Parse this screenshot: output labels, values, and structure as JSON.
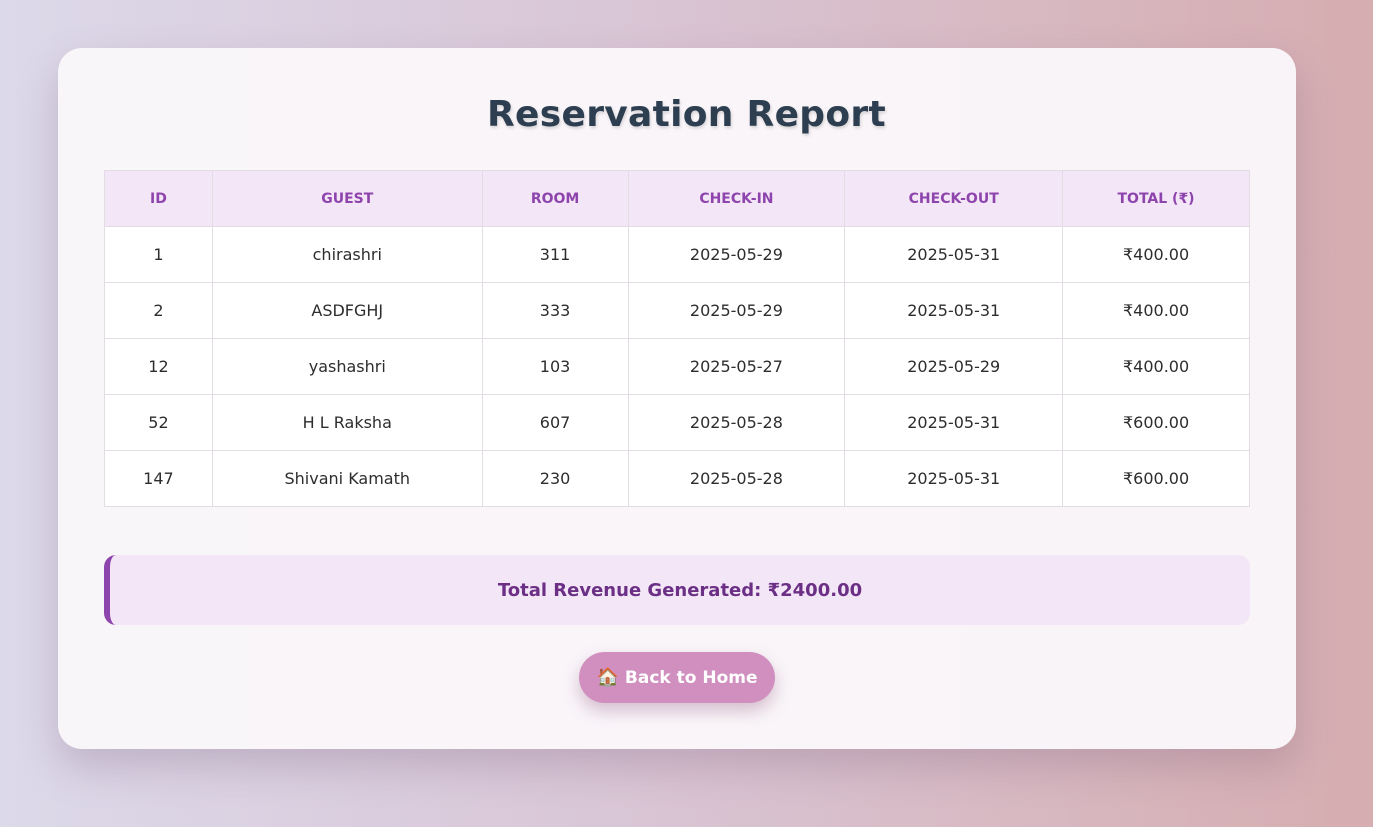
{
  "page": {
    "title": "Reservation Report"
  },
  "table": {
    "headers": [
      "ID",
      "GUEST",
      "ROOM",
      "CHECK-IN",
      "CHECK-OUT",
      "TOTAL (₹)"
    ],
    "rows": [
      [
        "1",
        "chirashri",
        "311",
        "2025-05-29",
        "2025-05-31",
        "₹400.00"
      ],
      [
        "2",
        "ASDFGHJ",
        "333",
        "2025-05-29",
        "2025-05-31",
        "₹400.00"
      ],
      [
        "12",
        "yashashri",
        "103",
        "2025-05-27",
        "2025-05-29",
        "₹400.00"
      ],
      [
        "52",
        "H L Raksha",
        "607",
        "2025-05-28",
        "2025-05-31",
        "₹600.00"
      ],
      [
        "147",
        "Shivani Kamath",
        "230",
        "2025-05-28",
        "2025-05-31",
        "₹600.00"
      ]
    ]
  },
  "summary": {
    "revenue_text": "Total Revenue Generated: ₹2400.00"
  },
  "actions": {
    "back_icon": "🏠",
    "back_icon_name": "house-icon",
    "back_label": "Back to Home"
  },
  "colors": {
    "accent": "#8e44ad",
    "header_bg": "#f3e6f6",
    "button_bg": "#d08fbe",
    "title": "#2c3e50"
  }
}
